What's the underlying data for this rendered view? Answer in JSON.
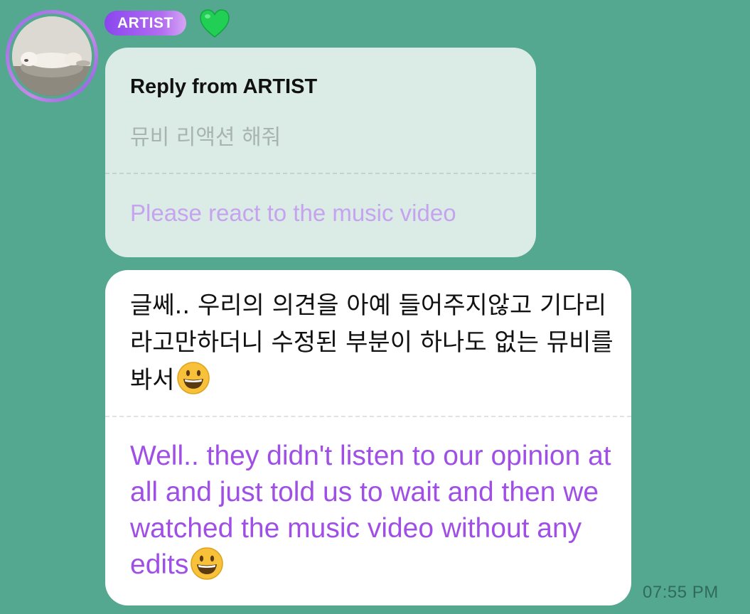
{
  "sender": {
    "badge_label": "ARTIST",
    "heart_icon": "green-heart-icon",
    "heart_color": "#27d85c",
    "avatar_icon": "sleeping-dog-photo"
  },
  "reply": {
    "title": "Reply from ARTIST",
    "original_korean": "뮤비 리액션 해줘",
    "original_translation": "Please react to the music video"
  },
  "message": {
    "korean": "글쎄.. 우리의 의견을 아예 들어주지않고 기다리라고만하더니 수정된 부분이 하나도 없는 뮤비를 봐서",
    "translation": "Well.. they didn't listen to our opinion at all and just told us to wait and then we watched the music video without any edits",
    "emoji_icon": "grinning-face-icon",
    "time": "07:55 PM"
  },
  "colors": {
    "background": "#55a890",
    "reply_bubble": "#dbece7",
    "message_bubble": "#ffffff",
    "translation_text": "#a04fe6",
    "badge_gradient_start": "#8a46ee"
  }
}
